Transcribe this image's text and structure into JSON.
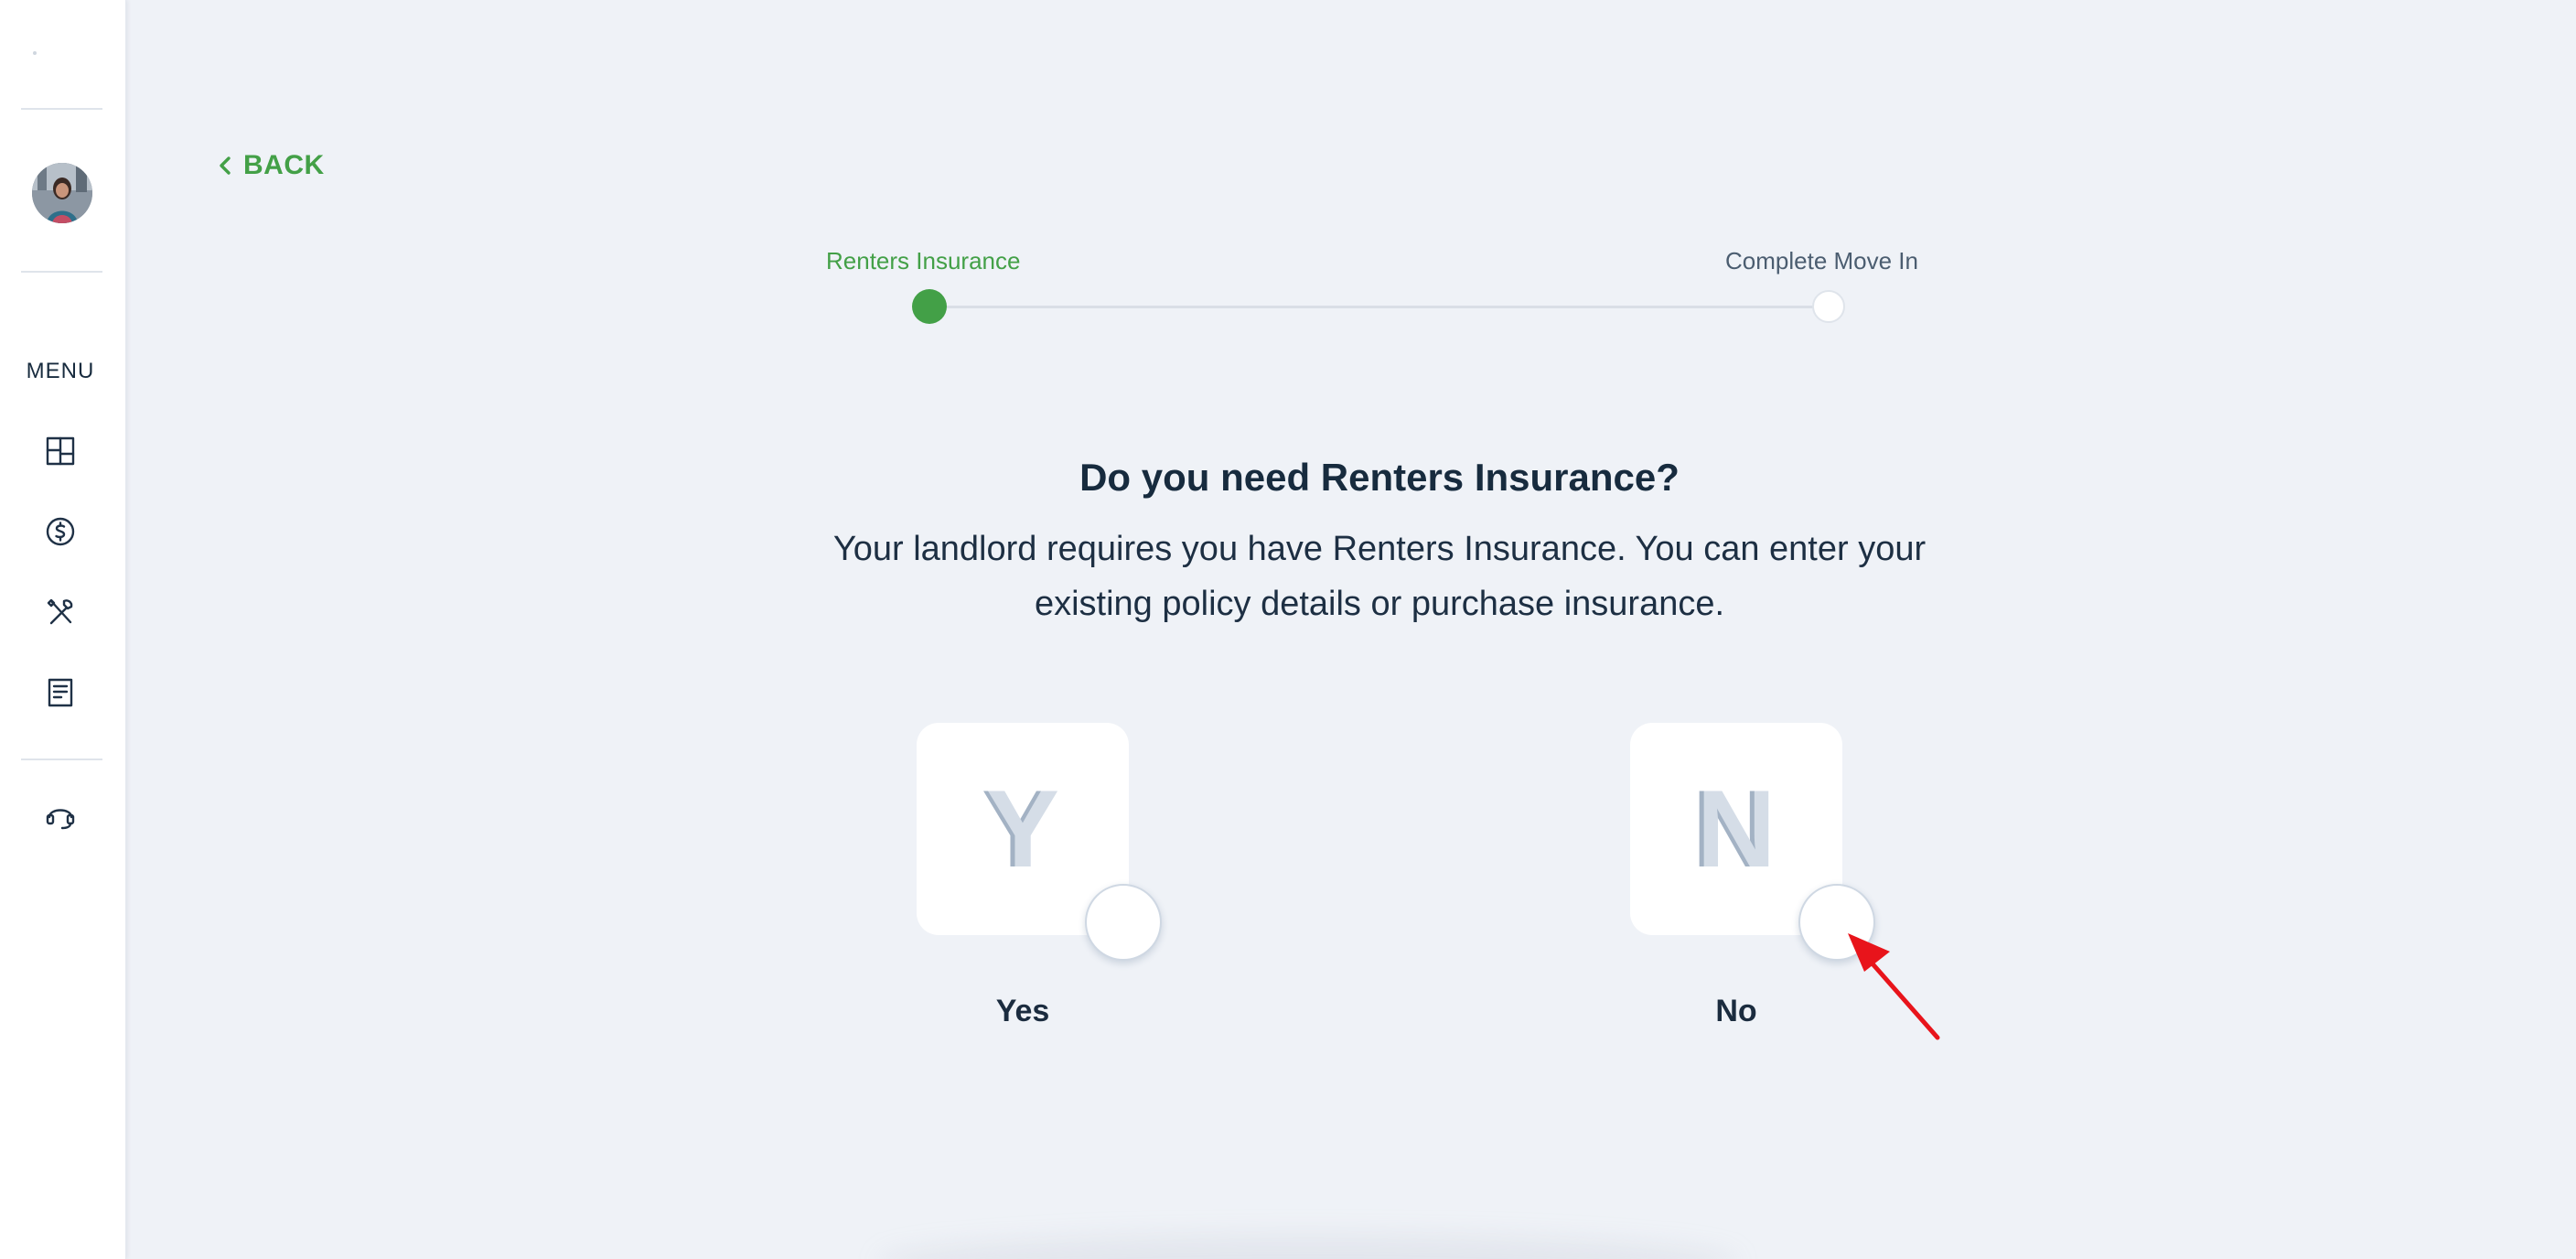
{
  "sidebar": {
    "menu_label": "MENU",
    "icons": [
      "dashboard-icon",
      "dollar-icon",
      "tools-icon",
      "document-icon",
      "headset-icon"
    ]
  },
  "back": {
    "label": "BACK"
  },
  "stepper": {
    "steps": [
      {
        "label": "Renters Insurance",
        "active": true
      },
      {
        "label": "Complete Move In",
        "active": false
      }
    ]
  },
  "question": {
    "title": "Do you need Renters Insurance?",
    "description": "Your landlord requires you have Renters Insurance. You can enter your existing policy details or purchase insurance."
  },
  "options": [
    {
      "letter": "Y",
      "label": "Yes",
      "selected": false
    },
    {
      "letter": "N",
      "label": "No",
      "selected": false
    }
  ],
  "colors": {
    "accent": "#43a047",
    "background": "#eff2f7",
    "text": "#172b3e",
    "annotation": "#e8141b"
  }
}
